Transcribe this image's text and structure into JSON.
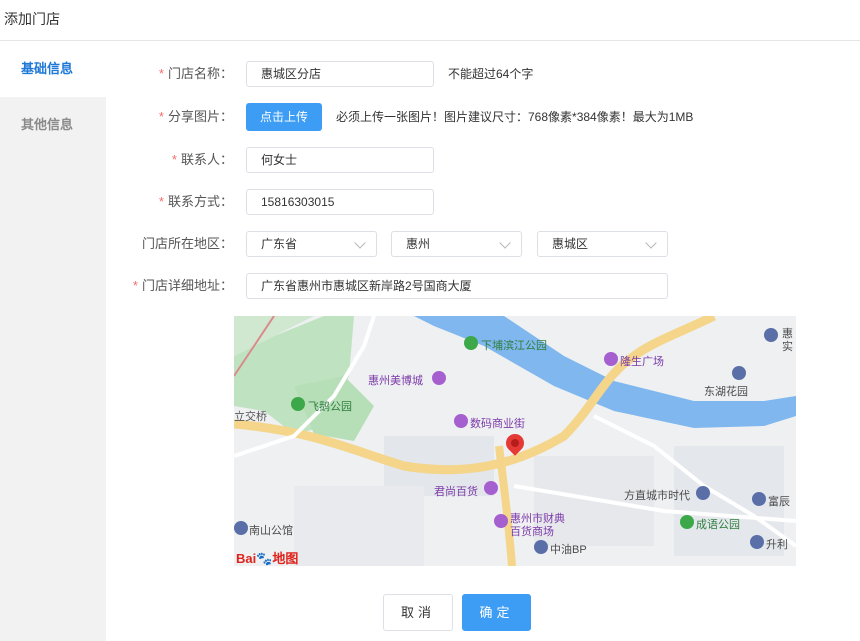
{
  "page": {
    "title": "添加门店"
  },
  "sidebar": {
    "tabs": [
      {
        "label": "基础信息",
        "active": true
      },
      {
        "label": "其他信息",
        "active": false
      }
    ]
  },
  "form": {
    "store_name": {
      "label": "门店名称：",
      "required": "*",
      "value": "惠城区分店",
      "hint": "不能超过64个字"
    },
    "share_image": {
      "label": "分享图片：",
      "required": "*",
      "button": "点击上传",
      "hint": "必须上传一张图片！图片建议尺寸：768像素*384像素！最大为1MB"
    },
    "contact": {
      "label": "联系人：",
      "required": "*",
      "value": "何女士"
    },
    "phone": {
      "label": "联系方式：",
      "required": "*",
      "value": "15816303015"
    },
    "region": {
      "label": "门店所在地区：",
      "province": "广东省",
      "city": "惠州",
      "district": "惠城区"
    },
    "address": {
      "label": "门店详细地址：",
      "required": "*",
      "value": "广东省惠州市惠城区新岸路2号国商大厦"
    }
  },
  "map": {
    "labels": {
      "xiapu_park": "下埔滨江公园",
      "longsheng": "隆生广场",
      "meibo": "惠州美博城",
      "donghu": "东湖花园",
      "feie": "飞鹅公园",
      "lijiaoqiao": "立交桥",
      "shuma": "数码商业街",
      "junshang": "君尚百货",
      "fangzhi": "方直城市时代",
      "nanshan": "南山公馆",
      "caidian": "惠州市财典",
      "baihuo": "百货商场",
      "zhongyou": "中油BP",
      "chengyu": "成语公园",
      "fuchen": "富辰",
      "shenglv": "升利",
      "huishi": "惠",
      "shi": "实"
    },
    "logo_text": "Bai",
    "logo_text2": "地图"
  },
  "actions": {
    "cancel": "取消",
    "ok": "确定"
  },
  "colors": {
    "accent": "#3d9df5",
    "required": "#f56c6c",
    "tab_active": "#1e78d8"
  }
}
